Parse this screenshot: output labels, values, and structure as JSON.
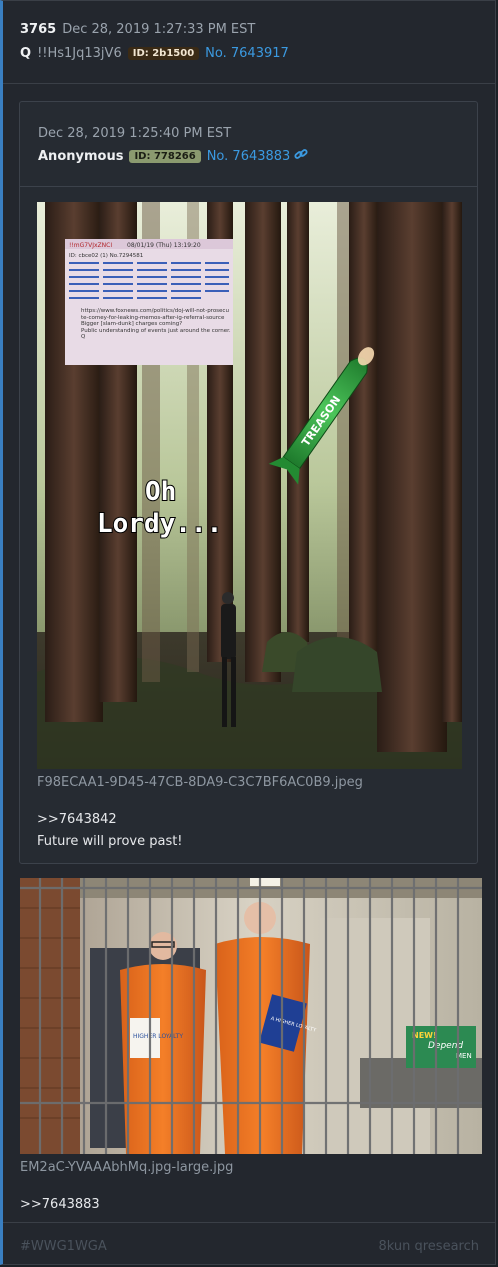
{
  "post": {
    "number": "3765",
    "date": "Dec 28, 2019 1:27:33 PM EST",
    "name": "Q",
    "tripcode": "!!Hs1Jq13jV6",
    "id_label": "ID: 2b1500",
    "post_link": "No. 7643917"
  },
  "quoted": {
    "date": "Dec 28, 2019 1:25:40 PM EST",
    "name": "Anonymous",
    "id_label": "ID: 778266",
    "post_link": "No. 7643883",
    "image": {
      "overlay_text_line1": "Oh",
      "overlay_text_line2": "Lordy...",
      "missile_label": "TREASON",
      "note_header_name": "!!mG7VJxZNCI",
      "note_header_date": "08/01/19 (Thu) 13:19:20",
      "note_id_line": "ID: cbce02 (1)  No.7294581",
      "note_url": "https://www.foxnews.com/politics/doj-will-not-prosecute-comey-for-leaking-memos-after-ig-referral-source",
      "note_q1": "Bigger [slam-dunk] charges coming?",
      "note_q2": "Public understanding of events just around the corner.",
      "note_sign": "Q"
    },
    "filename": "F98ECAA1-9D45-47CB-8DA9-C3C7BF6AC0B9.jpeg",
    "reply_ref": ">>7643842",
    "message": "Future will prove past!"
  },
  "attachment": {
    "filename": "EM2aC-YVAAAbhMq.jpg-large.jpg",
    "reply_ref": ">>7643883",
    "book_left_text": "HIGHER LOYALTY",
    "book_right_text": "A HIGHER LOYALTY",
    "box_label_1": "NEW!",
    "box_label_2": "Depend",
    "box_label_3": "MEN"
  },
  "footer": {
    "hashtag": "#WWG1WGA",
    "board": "8kun qresearch"
  },
  "colors": {
    "accent": "#3b9ae1",
    "background": "#23272e",
    "prison_orange": "#f07a1e"
  }
}
